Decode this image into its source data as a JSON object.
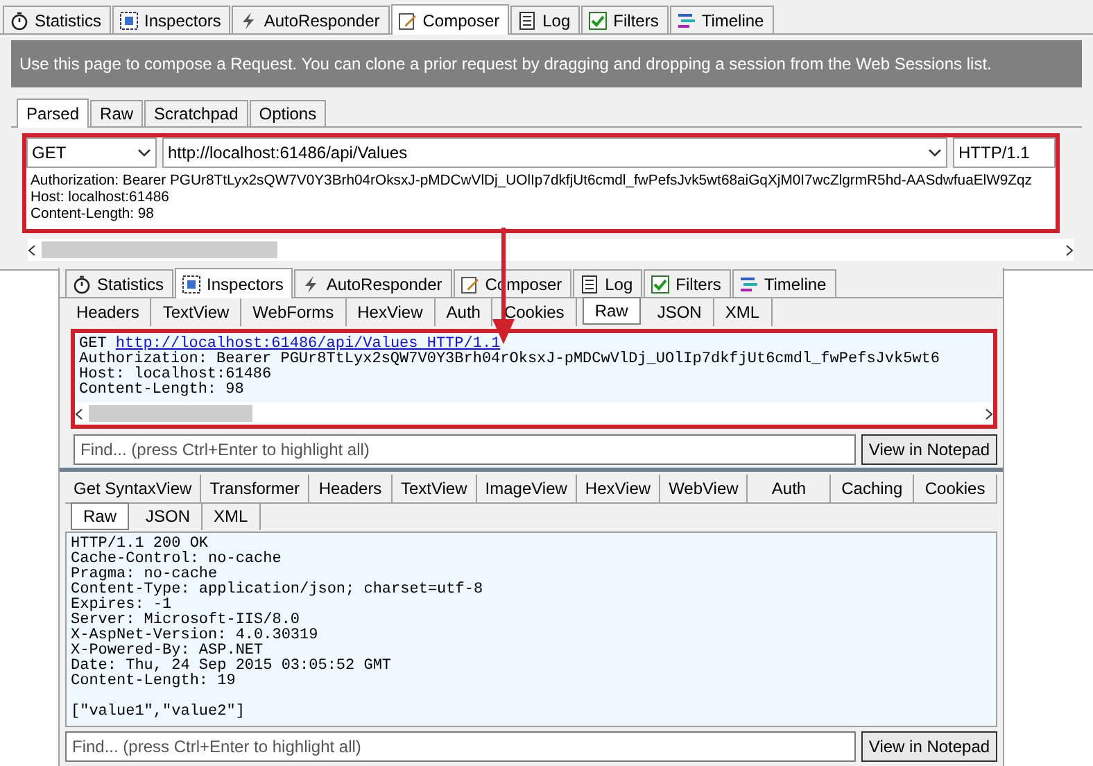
{
  "composer": {
    "tabs": [
      {
        "label": "Statistics",
        "kind": "stopwatch",
        "selected": false
      },
      {
        "label": "Inspectors",
        "kind": "inspect",
        "selected": false
      },
      {
        "label": "AutoResponder",
        "kind": "bolt",
        "selected": false
      },
      {
        "label": "Composer",
        "kind": "compose",
        "selected": true
      },
      {
        "label": "Log",
        "kind": "log",
        "selected": false
      },
      {
        "label": "Filters",
        "kind": "check",
        "selected": false
      },
      {
        "label": "Timeline",
        "kind": "timeline",
        "selected": false
      }
    ],
    "notice": "Use this page to compose a Request. You can clone a prior request by dragging and dropping a session from the Web Sessions list.",
    "sub_tabs": [
      {
        "label": "Parsed",
        "selected": true
      },
      {
        "label": "Raw",
        "selected": false
      },
      {
        "label": "Scratchpad",
        "selected": false
      },
      {
        "label": "Options",
        "selected": false
      }
    ],
    "method": "GET",
    "url": "http://localhost:61486/api/Values",
    "version": "HTTP/1.1",
    "headers": [
      "Authorization: Bearer PGUr8TtLyx2sQW7V0Y3Brh04rOksxJ-pMDCwVlDj_UOlIp7dkfjUt6cmdl_fwPefsJvk5wt68aiGqXjM0I7wcZlgrmR5hd-AASdwfuaElW9Zqz",
      "Host: localhost:61486",
      "Content-Length: 98"
    ]
  },
  "inspector": {
    "tabs": [
      {
        "label": "Statistics",
        "kind": "stopwatch",
        "selected": false
      },
      {
        "label": "Inspectors",
        "kind": "inspect",
        "selected": true
      },
      {
        "label": "AutoResponder",
        "kind": "bolt",
        "selected": false
      },
      {
        "label": "Composer",
        "kind": "compose",
        "selected": false
      },
      {
        "label": "Log",
        "kind": "log",
        "selected": false
      },
      {
        "label": "Filters",
        "kind": "check",
        "selected": false
      },
      {
        "label": "Timeline",
        "kind": "timeline",
        "selected": false
      }
    ],
    "request": {
      "tabs": [
        {
          "label": "Headers",
          "selected": false
        },
        {
          "label": "TextView",
          "selected": false
        },
        {
          "label": "WebForms",
          "selected": false
        },
        {
          "label": "HexView",
          "selected": false
        },
        {
          "label": "Auth",
          "selected": false
        },
        {
          "label": "Cookies",
          "selected": false
        },
        {
          "label": "Raw",
          "selected": true
        },
        {
          "label": "JSON",
          "selected": false
        },
        {
          "label": "XML",
          "selected": false
        }
      ],
      "method": "GET",
      "link": "http://localhost:61486/api/Values HTTP/1.1",
      "lines": [
        "Authorization: Bearer PGUr8TtLyx2sQW7V0Y3Brh04rOksxJ-pMDCwVlDj_UOlIp7dkfjUt6cmdl_fwPefsJvk5wt6",
        "Host: localhost:61486",
        "Content-Length: 98"
      ],
      "find_placeholder": "Find... (press Ctrl+Enter to highlight all)",
      "notepad_button": "View in Notepad"
    },
    "response": {
      "tabs": [
        {
          "label": "Get SyntaxView",
          "selected": false
        },
        {
          "label": "Transformer",
          "selected": false
        },
        {
          "label": "Headers",
          "selected": false
        },
        {
          "label": "TextView",
          "selected": false
        },
        {
          "label": "ImageView",
          "selected": false
        },
        {
          "label": "HexView",
          "selected": false
        },
        {
          "label": "WebView",
          "selected": false
        },
        {
          "label": "Auth",
          "selected": false
        },
        {
          "label": "Caching",
          "selected": false
        },
        {
          "label": "Cookies",
          "selected": false
        }
      ],
      "sub_tabs": [
        {
          "label": "Raw",
          "selected": true
        },
        {
          "label": "JSON",
          "selected": false
        },
        {
          "label": "XML",
          "selected": false
        }
      ],
      "lines": [
        "HTTP/1.1 200 OK",
        "Cache-Control: no-cache",
        "Pragma: no-cache",
        "Content-Type: application/json; charset=utf-8",
        "Expires: -1",
        "Server: Microsoft-IIS/8.0",
        "X-AspNet-Version: 4.0.30319",
        "X-Powered-By: ASP.NET",
        "Date: Thu, 24 Sep 2015 03:05:52 GMT",
        "Content-Length: 19"
      ],
      "body": "[\"value1\",\"value2\"]",
      "find_placeholder": "Find... (press Ctrl+Enter to highlight all)",
      "notepad_button": "View in Notepad"
    }
  }
}
